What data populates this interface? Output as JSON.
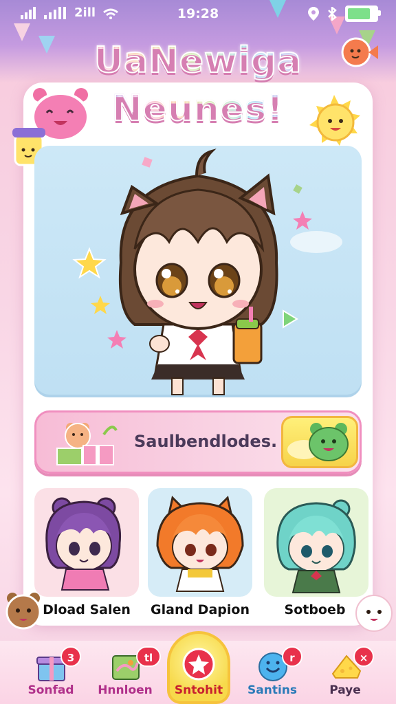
{
  "status": {
    "time": "19:28",
    "carrier": "2ill",
    "battery_percent": 85
  },
  "app": {
    "title_line1": "UaNewiga",
    "title_line2": "Neunes!"
  },
  "banner": {
    "label": "Saulbendlodes."
  },
  "characters": [
    {
      "name": "Dload Salen"
    },
    {
      "name": "Gland Dapion"
    },
    {
      "name": "Sotboeb"
    }
  ],
  "tabs": [
    {
      "label": "Sonfad",
      "badge": "3",
      "icon": "gift-box-icon"
    },
    {
      "label": "Hnnloen",
      "badge": "tl",
      "icon": "map-icon"
    },
    {
      "label": "Sntohit",
      "badge": "",
      "icon": "star-icon"
    },
    {
      "label": "Santins",
      "badge": "r",
      "icon": "smile-icon"
    },
    {
      "label": "Paye",
      "badge": "×",
      "icon": "cheese-icon"
    }
  ],
  "colors": {
    "accent_pink": "#f05aa4",
    "badge_red": "#e8314b",
    "tab_center_yellow": "#f7d94b"
  }
}
